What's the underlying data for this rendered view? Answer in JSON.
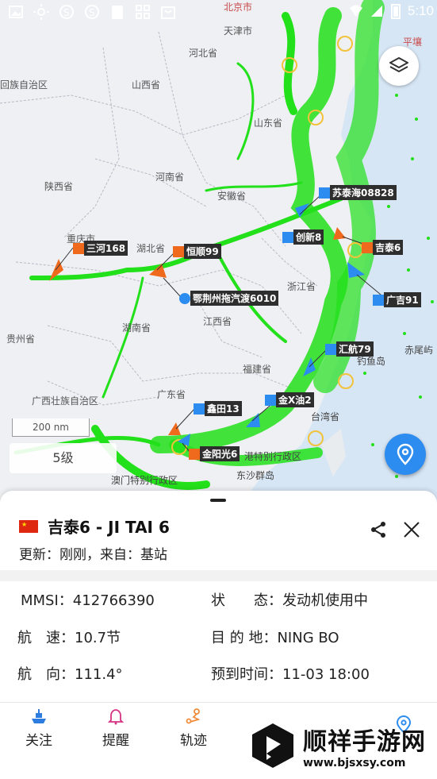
{
  "status_bar": {
    "time": "5:10"
  },
  "map": {
    "places": [
      {
        "id": "beijing",
        "text": "北京市"
      },
      {
        "id": "tianjin",
        "text": "天津市"
      },
      {
        "id": "hebei",
        "text": "河北省"
      },
      {
        "id": "ningxia",
        "text": "回族自治区"
      },
      {
        "id": "shanxi",
        "text": "山西省"
      },
      {
        "id": "shandong",
        "text": "山东省"
      },
      {
        "id": "henan",
        "text": "河南省"
      },
      {
        "id": "shaanxi",
        "text": "陕西省"
      },
      {
        "id": "anhui",
        "text": "安徽省"
      },
      {
        "id": "chongqing",
        "text": "重庆市"
      },
      {
        "id": "hubei",
        "text": "湖北省"
      },
      {
        "id": "zhejiang",
        "text": "浙江省"
      },
      {
        "id": "jiangxi",
        "text": "江西省"
      },
      {
        "id": "hunan",
        "text": "湖南省"
      },
      {
        "id": "guizhou",
        "text": "贵州省"
      },
      {
        "id": "fujian",
        "text": "福建省"
      },
      {
        "id": "guangxi",
        "text": "广西壮族自治区"
      },
      {
        "id": "guangdong",
        "text": "广东省"
      },
      {
        "id": "taiwan",
        "text": "台湾省"
      },
      {
        "id": "hk",
        "text": "港特别行政区"
      },
      {
        "id": "macau",
        "text": "澳门特别行政区"
      },
      {
        "id": "dongsha",
        "text": "东沙群岛"
      },
      {
        "id": "diaoyu",
        "text": "钓鱼岛"
      },
      {
        "id": "chiwei",
        "text": "赤尾屿"
      },
      {
        "id": "pingrang",
        "text": "平壤"
      }
    ],
    "ships": [
      {
        "id": "sutaihai",
        "name": "苏泰海08828",
        "tag_color": "#2d8cf0"
      },
      {
        "id": "chuangxin",
        "name": "创新8",
        "tag_color": "#2d8cf0"
      },
      {
        "id": "jitai",
        "name": "吉泰6",
        "tag_color": "#f06a1e"
      },
      {
        "id": "guangji",
        "name": "广吉91",
        "tag_color": "#2d8cf0"
      },
      {
        "id": "sanhe",
        "name": "三河168",
        "tag_color": "#f06a1e"
      },
      {
        "id": "hengshun",
        "name": "恒顺99",
        "tag_color": "#f06a1e"
      },
      {
        "id": "ejingzhou",
        "name": "鄂荆州拖汽渡6010",
        "tag_color": "#2d8cf0"
      },
      {
        "id": "huihang",
        "name": "汇航79",
        "tag_color": "#2d8cf0"
      },
      {
        "id": "jinxyou",
        "name": "金X油2",
        "tag_color": "#2d8cf0"
      },
      {
        "id": "xintian",
        "name": "鑫田13",
        "tag_color": "#2d8cf0"
      },
      {
        "id": "jinyangguang",
        "name": "金阳光6",
        "tag_color": "#f06a1e"
      }
    ],
    "scale_label": "200 nm",
    "zoom_label": "5级"
  },
  "ship_detail": {
    "title": "吉泰6 - JI TAI 6",
    "update_text": "更新：刚刚，来自：基站",
    "fields": [
      {
        "label": "MMSI：",
        "value": "412766390"
      },
      {
        "label": "状　　态：",
        "value": "发动机使用中"
      },
      {
        "label": "航　速：",
        "value": "10.7节"
      },
      {
        "label": "目 的 地：",
        "value": "NING BO"
      },
      {
        "label": "航　向：",
        "value": "111.4°"
      },
      {
        "label": "预到时间：",
        "value": "11-03 18:00"
      }
    ]
  },
  "tabs": [
    {
      "label": "关注",
      "icon": "ship-icon"
    },
    {
      "label": "提醒",
      "icon": "bell-icon"
    },
    {
      "label": "轨迹",
      "icon": "route-icon"
    }
  ],
  "watermark": {
    "title": "顺祥手游网",
    "url": "www.bjsxsy.com"
  },
  "colors": {
    "ship_traffic": "#22e01a",
    "sea": "#d7e6f5",
    "accent_blue": "#2d8cf0",
    "accent_orange": "#f06a1e"
  }
}
